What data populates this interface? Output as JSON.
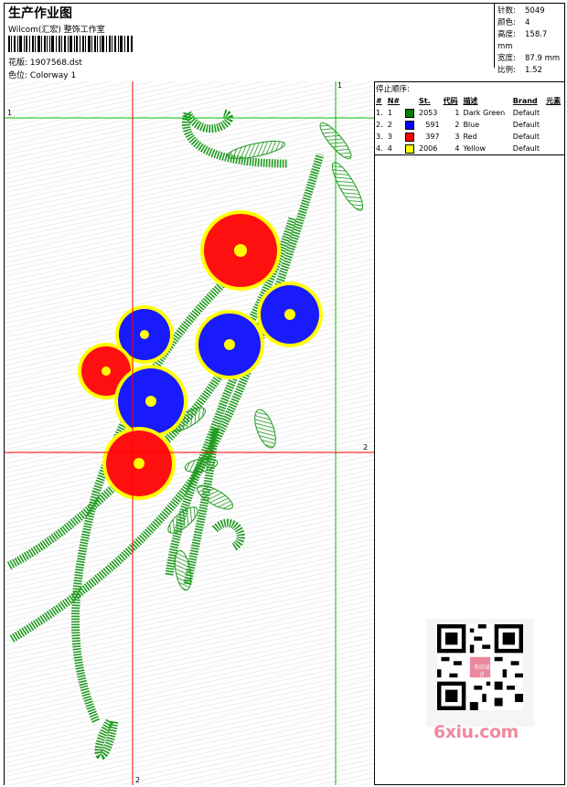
{
  "header": {
    "title": "生产作业图",
    "company": "Wilcom(汇宏) 整饰工作室",
    "file_label": "花版:",
    "file_value": "1907568.dst",
    "colorway_label": "色位:",
    "colorway_value": "Colorway 1"
  },
  "stats": {
    "stitches_label": "针数:",
    "stitches_value": "5049",
    "colors_label": "颜色:",
    "colors_value": "4",
    "height_label": "高度:",
    "height_value": "158.7 mm",
    "width_label": "宽度:",
    "width_value": "87.9 mm",
    "scale_label": "比例:",
    "scale_value": "1.52"
  },
  "guides": {
    "v1": "1",
    "h1": "1",
    "v2": "2",
    "h2": "2"
  },
  "sequence": {
    "title": "停止顺序:",
    "headers": [
      "#",
      "N#",
      "St.",
      "代码",
      "描述",
      "Brand",
      "元素"
    ],
    "rows": [
      {
        "idx": "1.",
        "n": "1",
        "st": "2053",
        "code": "1",
        "desc": "Dark Green",
        "brand": "Default",
        "color": "#008000"
      },
      {
        "idx": "2.",
        "n": "2",
        "st": "591",
        "code": "2",
        "desc": "Blue",
        "brand": "Default",
        "color": "#0000ff"
      },
      {
        "idx": "3.",
        "n": "3",
        "st": "397",
        "code": "3",
        "desc": "Red",
        "brand": "Default",
        "color": "#ff0000"
      },
      {
        "idx": "4.",
        "n": "4",
        "st": "2006",
        "code": "4",
        "desc": "Yellow",
        "brand": "Default",
        "color": "#ffff00"
      }
    ]
  },
  "watermark": {
    "text": "6xiu.com",
    "stamp": "东印设计"
  },
  "colors": {
    "guide_red": "#ff0000",
    "guide_green": "#00c000",
    "stitch_green": "#1f9a1f",
    "petal_blue": "#1a1aff",
    "petal_red": "#ff1010",
    "outline_yellow": "#ffff00"
  }
}
